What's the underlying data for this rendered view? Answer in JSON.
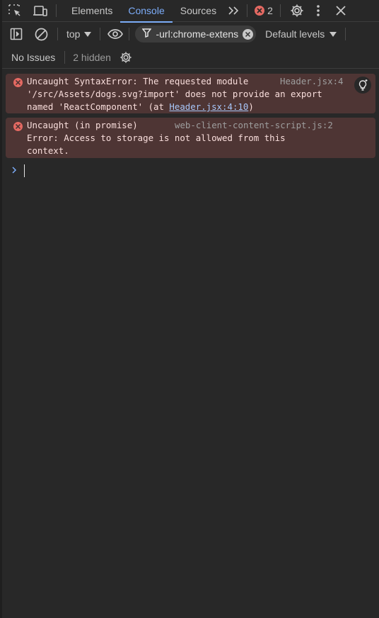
{
  "tabs": {
    "elements": "Elements",
    "console": "Console",
    "sources": "Sources",
    "more": "»",
    "error_count": "2"
  },
  "toolbar": {
    "context": "top",
    "filter_value": "-url:chrome-extens",
    "levels": "Default levels"
  },
  "issues": {
    "label": "No Issues",
    "hidden": "2 hidden"
  },
  "messages": [
    {
      "lines": [
        "Uncaught SyntaxError: The requested module",
        "'/src/Assets/dogs.svg?import' does not provide an export",
        "named 'ReactComponent' (at "
      ],
      "link": "Header.jsx:4:10",
      "after_link": ")",
      "source": "Header.jsx:4"
    },
    {
      "lines": [
        "Uncaught (in promise)",
        "Error: Access to storage is not allowed from this",
        "context."
      ],
      "source": "web-client-content-script.js:2"
    }
  ],
  "colors": {
    "background": "#282828",
    "accent": "#7cacf8",
    "error_bg": "#4e3534",
    "error_text": "#f9dedc",
    "error_icon": "#e46962"
  }
}
